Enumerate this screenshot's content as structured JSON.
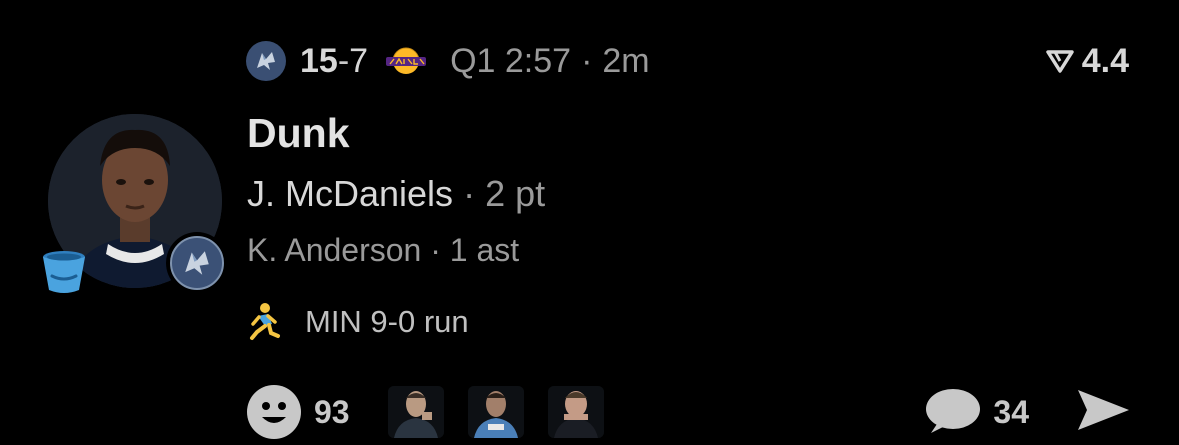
{
  "header": {
    "home_team_icon": "timberwolves-logo-icon",
    "home_score": "15",
    "score_separator": "-",
    "away_score": "7",
    "away_team_icon": "lakers-logo-icon",
    "game_clock": "Q1 2:57",
    "separator": "·",
    "time_ago": "2m",
    "rating_icon": "rating-flag-icon",
    "rating_value": "4.4"
  },
  "play": {
    "type": "Dunk",
    "scorer": "J. McDaniels",
    "separator": "·",
    "points": "2 pt",
    "assister": "K. Anderson",
    "assists": "1 ast",
    "run_icon": "running-person-icon",
    "run_text": "MIN 9-0 run"
  },
  "avatar": {
    "player_photo": "player-photo",
    "badge_icon": "bucket-icon",
    "team_badge_icon": "timberwolves-logo-icon"
  },
  "footer": {
    "reaction_icon": "smiley-face-icon",
    "reaction_count": "93",
    "reactor_avatars": [
      "reactor-avatar-1",
      "reactor-avatar-2",
      "reactor-avatar-3"
    ],
    "comment_icon": "speech-bubble-icon",
    "comment_count": "34",
    "share_icon": "send-arrow-icon"
  },
  "colors": {
    "background": "#000000",
    "primary_text": "#e3e3e3",
    "secondary_text": "#9a9a9a",
    "icon_gray": "#c8c8c8",
    "wolves_blue": "#3b5176",
    "lakers_purple": "#552583",
    "lakers_gold": "#fdb927",
    "bucket_blue": "#4aa3df"
  }
}
